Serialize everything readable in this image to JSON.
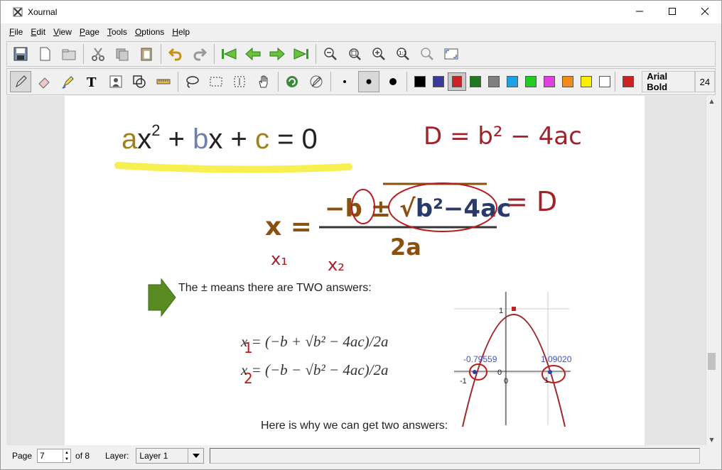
{
  "window": {
    "title": "Xournal"
  },
  "menu": [
    "File",
    "Edit",
    "View",
    "Page",
    "Tools",
    "Options",
    "Help"
  ],
  "toolbar_icons": [
    "save-icon",
    "new-page-icon",
    "open-folder-icon",
    "cut-icon",
    "copy-icon",
    "paste-icon",
    "undo-icon",
    "redo-icon",
    "first-page-icon",
    "previous-page-icon",
    "next-page-icon",
    "last-page-icon",
    "zoom-out-icon",
    "zoom-fit-icon",
    "zoom-in-icon",
    "zoom-100-icon",
    "zoom-set-icon",
    "fullscreen-icon"
  ],
  "tools": {
    "font_name": "Arial Bold",
    "font_size": "24",
    "colors": [
      "#000000",
      "#3a3a9a",
      "#cc2222",
      "#1e7a1e",
      "#808080",
      "#1ea0e6",
      "#22cc22",
      "#e040e0",
      "#f08c1e",
      "#f8f000",
      "#ffffff"
    ],
    "selected_color": "#cc2222",
    "current_color": "#cc2222"
  },
  "status": {
    "page_label": "Page",
    "page_value": "7",
    "of_label": "of 8",
    "layer_label": "Layer:",
    "layer_value": "Layer 1"
  },
  "slide": {
    "text_line": "The ± means there are TWO answers:",
    "bottom_text": "Here is why we can get two answers:",
    "eq_x1": "x = (−b + √b² − 4ac)/2a",
    "eq_x2": "x = (−b − √b² − 4ac)/2a",
    "graph": {
      "label_left_root": "-0.79559",
      "label_right_root": "1.09020",
      "tick_top": "1",
      "tick_left": "-1",
      "tick_origin_a": "0",
      "tick_origin_b": "0",
      "tick_right": "1"
    }
  },
  "ink": {
    "quadratic": "ax² + bx + c = 0",
    "discriminant": "D = b² − 4ac",
    "formula_x": "x =",
    "formula_num": "−b ± √b² − 4ac",
    "formula_den": "2a",
    "equals_D": "= D",
    "x1_label": "x₁",
    "x2_label": "x₂"
  }
}
